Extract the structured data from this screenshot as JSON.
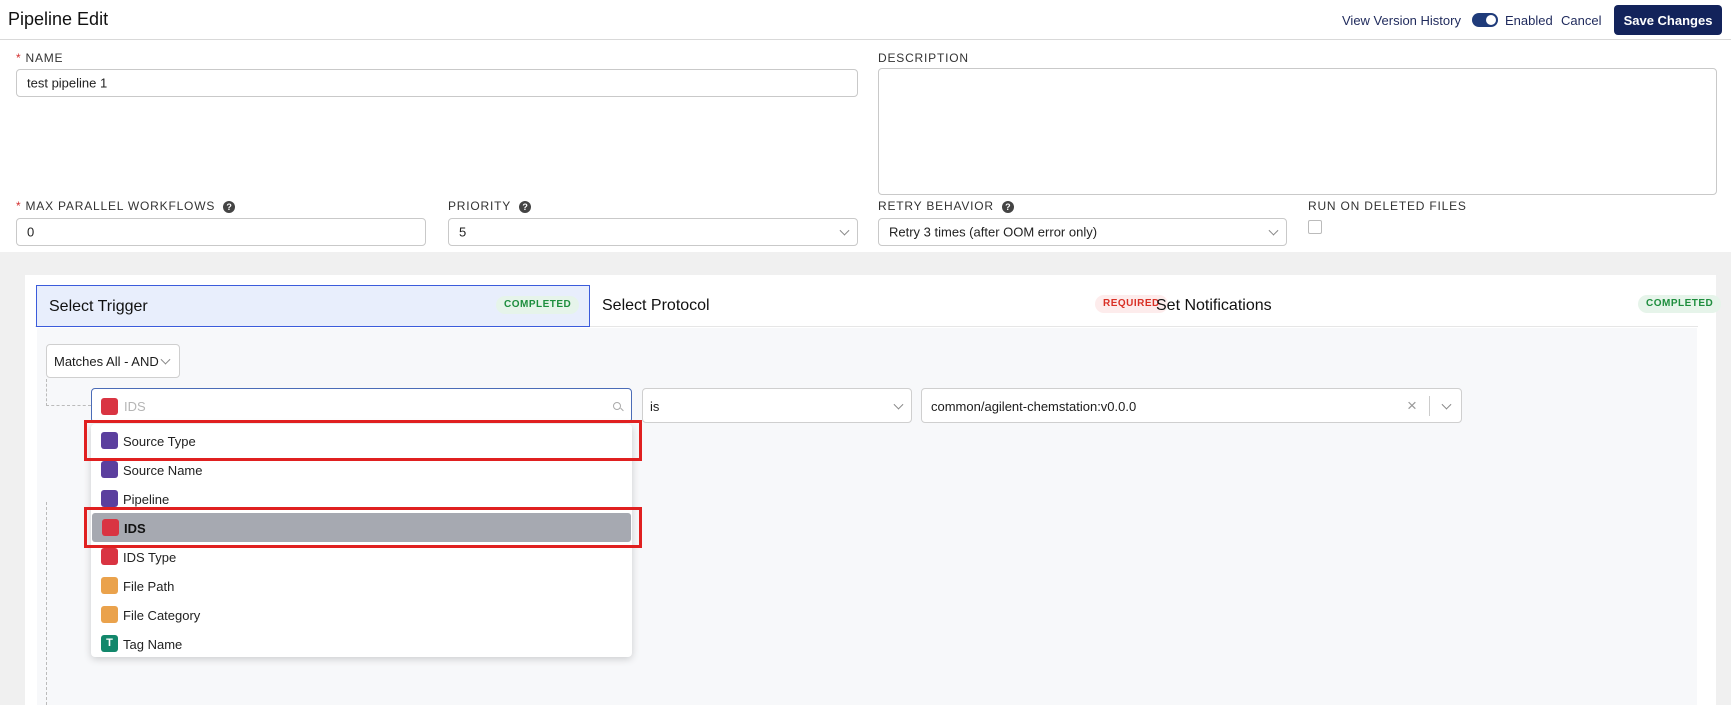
{
  "header": {
    "title": "Pipeline Edit",
    "view_version_history": "View Version History",
    "enabled_label": "Enabled",
    "enabled": true,
    "cancel_label": "Cancel",
    "save_label": "Save Changes"
  },
  "form": {
    "name": {
      "label": "NAME",
      "required_mark": "*",
      "value": "test pipeline 1"
    },
    "description": {
      "label": "DESCRIPTION",
      "value": ""
    },
    "max_parallel": {
      "label": "MAX PARALLEL WORKFLOWS",
      "required_mark": "*",
      "help": "?",
      "value": "0"
    },
    "priority": {
      "label": "PRIORITY",
      "help": "?",
      "value": "5"
    },
    "retry": {
      "label": "RETRY BEHAVIOR",
      "help": "?",
      "value": "Retry 3 times (after OOM error only)"
    },
    "run_on_deleted": {
      "label": "RUN ON DELETED FILES",
      "checked": false
    }
  },
  "steps": [
    {
      "title": "Select Trigger",
      "status": "COMPLETED"
    },
    {
      "title": "Select Protocol",
      "status": "REQUIRED"
    },
    {
      "title": "Set Notifications",
      "status": "COMPLETED"
    }
  ],
  "builder": {
    "matches_value": "Matches All - AND",
    "field_placeholder": "IDS",
    "operator_value": "is",
    "value_text": "common/agilent-chemstation:v0.0.0",
    "clear_symbol": "×"
  },
  "dropdown": {
    "options": [
      {
        "label": "Source Type",
        "color": "#5b3f9e"
      },
      {
        "label": "Source Name",
        "color": "#5b3f9e"
      },
      {
        "label": "Pipeline",
        "color": "#5b3f9e"
      },
      {
        "label": "IDS",
        "color": "#d93442",
        "selected": true
      },
      {
        "label": "IDS Type",
        "color": "#d93442"
      },
      {
        "label": "File Path",
        "color": "#eaa24c"
      },
      {
        "label": "File Category",
        "color": "#eaa24c"
      },
      {
        "label": "Tag Name",
        "color": "#12876b",
        "glyph": "T"
      }
    ]
  },
  "colors": {
    "primary_button": "#13235b",
    "highlight_box": "#e02020",
    "completed_text": "#1e8e3e",
    "required_text": "#d93025"
  }
}
